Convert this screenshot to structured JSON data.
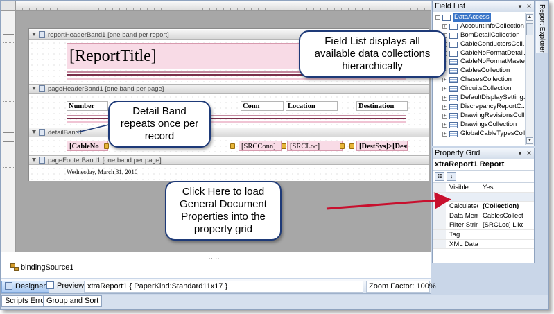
{
  "designer": {
    "report_header_band": "reportHeaderBand1 [one band per report]",
    "report_title": "[ReportTitle]",
    "page_header_band": "pageHeaderBand1 [one band per page]",
    "header_cells": [
      "Number",
      "Conn",
      "Location",
      "Destination"
    ],
    "detail_band": "detailBand1",
    "detail_cells": [
      "[CableNo",
      "[SRCConn]",
      "[SRCLoc]",
      "[DestSys]>[DestPin]"
    ],
    "page_footer_band": "pageFooterBand1 [one band per page]",
    "footer_date": "Wednesday, March 31, 2010",
    "binding_source": "bindingSource1"
  },
  "statusbar": {
    "designer_tab": "Designer",
    "preview_tab": "Preview",
    "report_info": "xtraReport1 { PaperKind:Standard11x17 }",
    "zoom": "Zoom Factor: 100%"
  },
  "bottom_tabs": [
    "Scripts Errors",
    "Group and Sort"
  ],
  "field_list": {
    "title": "Field List",
    "root": "DataAccess",
    "items": [
      "AccountInfoCollection",
      "BomDetailCollection",
      "CableConductorsColl...",
      "CableNoFormatDetail...",
      "CableNoFormatMaste...",
      "CablesCollection",
      "ChasesCollection",
      "CircuitsCollection",
      "DefaultDisplaySetting...",
      "DiscrepancyReportC...",
      "DrawingRevisionsColl...",
      "DrawingsCollection",
      "GlobalCableTypesColl..."
    ]
  },
  "property_grid": {
    "title": "Property Grid",
    "object": "xtraReport1  Report",
    "rows": [
      {
        "key": "Visible",
        "value": "Yes"
      },
      {
        "key": "",
        "value": "",
        "category": true
      },
      {
        "key": "Calculated F",
        "value": "(Collection)",
        "bold": true
      },
      {
        "key": "Data Memb",
        "value": "CablesCollection"
      },
      {
        "key": "Filter String",
        "value": "[SRCLoc] Like ..."
      },
      {
        "key": "Tag",
        "value": ""
      },
      {
        "key": "XML Data P",
        "value": ""
      }
    ]
  },
  "report_explorer": "Report Explorer",
  "callouts": {
    "field_list": "Field List displays all available data collections hierarchically",
    "detail_band": "Detail Band repeats once per record",
    "click_here": "Click Here to load General Document Properties into the property grid"
  },
  "colors": {
    "callout_border": "#1e3a78",
    "arrow": "#c8102e",
    "selection": "#3874c8",
    "field_pink": "#f8dbe6"
  }
}
